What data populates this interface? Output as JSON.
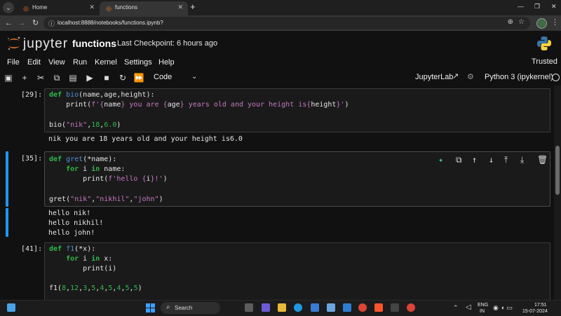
{
  "browser": {
    "tabs": [
      {
        "label": "Home",
        "favicon": "jupyter-favicon"
      },
      {
        "label": "functions",
        "favicon": "jupyter-favicon",
        "active": true
      }
    ],
    "url": "localhost:8888/notebooks/functions.ipynb?"
  },
  "header": {
    "wordmark": "jupyter",
    "notebook_title": "functions",
    "checkpoint": "Last Checkpoint: 6 hours ago"
  },
  "menu": [
    "File",
    "Edit",
    "View",
    "Run",
    "Kernel",
    "Settings",
    "Help"
  ],
  "trusted_label": "Trusted",
  "toolbar": {
    "cell_type": "Code",
    "jupyterlab_label": "JupyterLab",
    "kernel_name": "Python 3 (ipykernel)"
  },
  "cells": [
    {
      "prompt": "[29]:",
      "outputs": [
        "nik you are 18 years old and your height is6.0"
      ]
    },
    {
      "prompt": "[35]:",
      "outputs": [
        "hello nik!",
        "hello nikhil!",
        "hello john!"
      ]
    },
    {
      "prompt": "[41]:",
      "outputs": []
    }
  ],
  "taskbar": {
    "search_label": "Search",
    "lang_top": "ENG",
    "lang_bottom": "IN",
    "time": "17:51",
    "date": "15-07-2024"
  },
  "colors": {
    "keyword": "#2fb84b",
    "function_name": "#4f8fd8",
    "string": "#c777c4",
    "active_cell_bar": "#2196f3"
  }
}
